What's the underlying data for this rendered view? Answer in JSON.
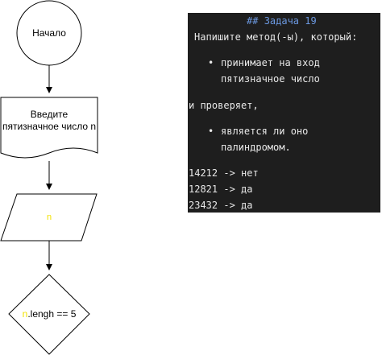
{
  "flowchart": {
    "start": {
      "label": "Начало"
    },
    "input_doc": {
      "line1": "Введите",
      "line2": "пятизначное число n"
    },
    "data_io": {
      "label": "n"
    },
    "decision": {
      "var": "n",
      "rest": ".lengh == 5"
    }
  },
  "note": {
    "heading_marker": "##",
    "heading_text": "Задача 19",
    "intro": "Напишите метод(-ы), который:",
    "bullet1_line1": "принимает на вход",
    "bullet1_line2": "пятизначное число",
    "middle": "и проверяет,",
    "bullet2_line1": "является ли оно",
    "bullet2_line2": "палиндромом.",
    "examples": [
      "14212 -> нет",
      "12821 -> да",
      "23432 -> да"
    ]
  },
  "colors": {
    "highlight": "#f2e200",
    "panel_bg": "#1e1e1e",
    "heading": "#6b98e0"
  }
}
